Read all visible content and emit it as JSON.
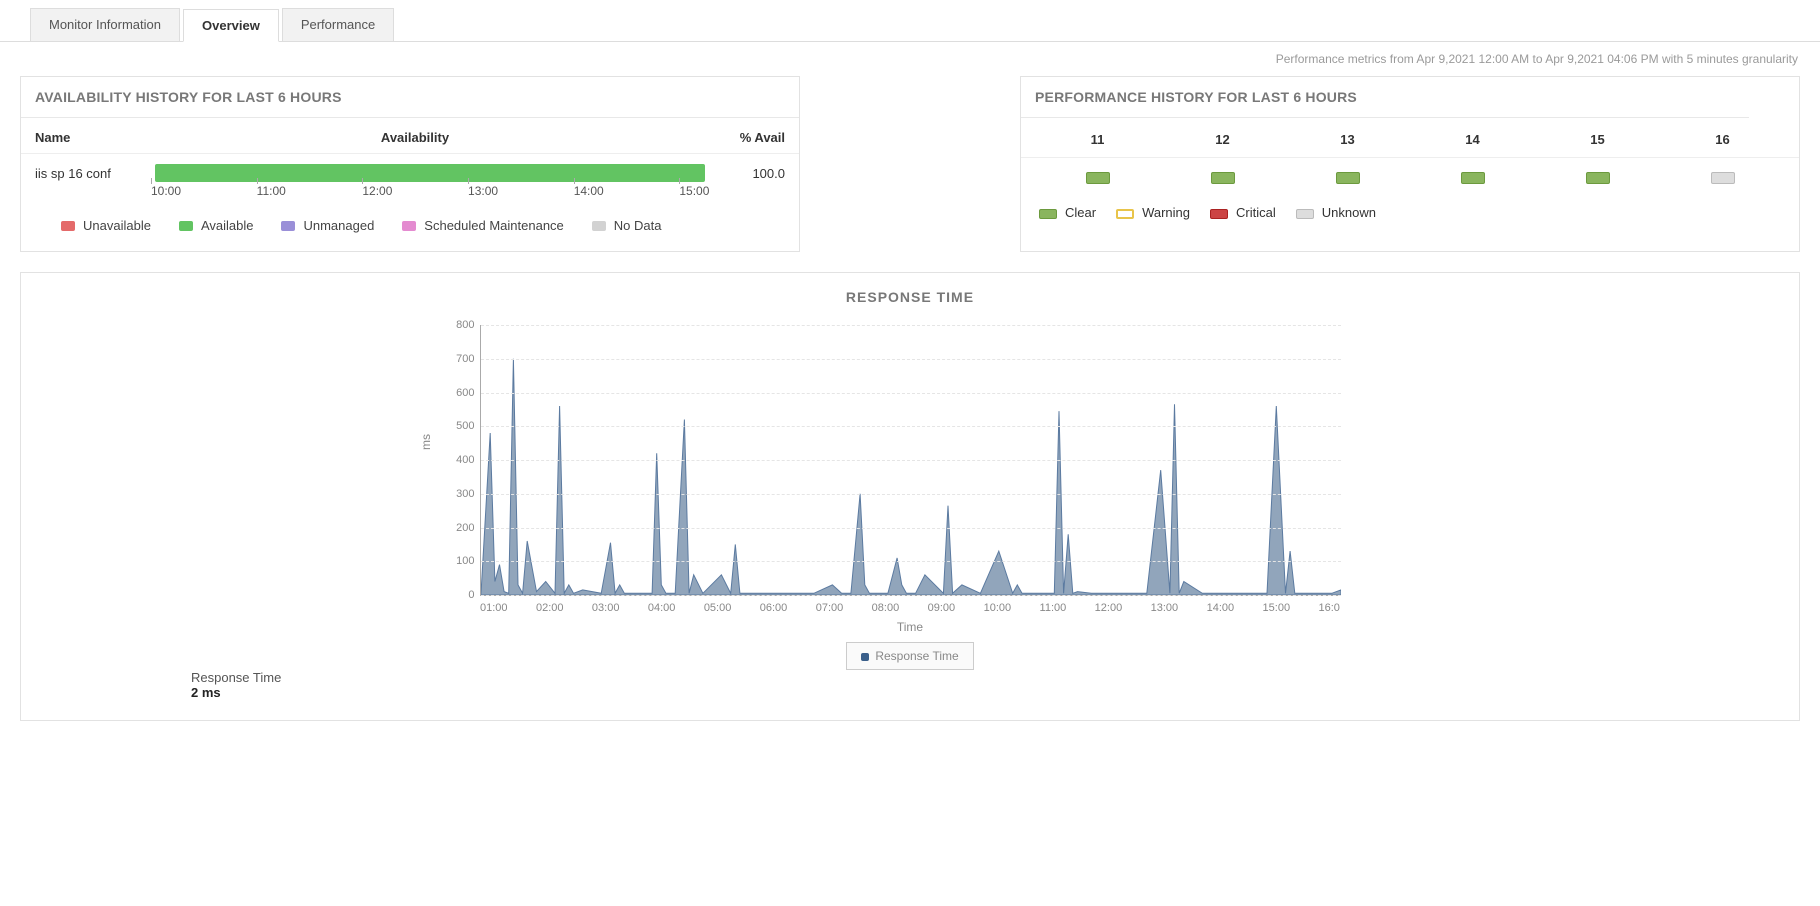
{
  "tabs": {
    "monitor_info": "Monitor Information",
    "overview": "Overview",
    "performance": "Performance"
  },
  "subtitle": "Performance metrics from Apr 9,2021 12:00 AM to Apr 9,2021 04:06 PM with 5 minutes granularity",
  "availability_panel": {
    "title": "AVAILABILITY HISTORY FOR LAST 6 HOURS",
    "head_name": "Name",
    "head_avail": "Availability",
    "head_pct": "% Avail",
    "row_name": "iis sp 16 conf",
    "row_pct": "100.0",
    "axis": [
      "10:00",
      "11:00",
      "12:00",
      "13:00",
      "14:00",
      "15:00"
    ],
    "legend": {
      "unavailable": "Unavailable",
      "available": "Available",
      "unmanaged": "Unmanaged",
      "scheduled": "Scheduled Maintenance",
      "nodata": "No Data"
    }
  },
  "performance_panel": {
    "title": "PERFORMANCE HISTORY FOR LAST 6 HOURS",
    "hours": [
      "11",
      "12",
      "13",
      "14",
      "15",
      "16"
    ],
    "statuses": [
      "clear",
      "clear",
      "clear",
      "clear",
      "clear",
      "unknown"
    ],
    "legend": {
      "clear": "Clear",
      "warning": "Warning",
      "critical": "Critical",
      "unknown": "Unknown"
    }
  },
  "response_panel": {
    "title": "RESPONSE TIME",
    "y_axis_label": "ms",
    "x_axis_label": "Time",
    "legend_label": "Response Time",
    "footer_label": "Response Time",
    "footer_value": "2 ms"
  },
  "chart_data": {
    "type": "area",
    "title": "RESPONSE TIME",
    "ylabel": "ms",
    "xlabel": "Time",
    "ylim": [
      0,
      800
    ],
    "y_ticks": [
      0,
      100,
      200,
      300,
      400,
      500,
      600,
      700,
      800
    ],
    "x_ticks": [
      "01:00",
      "02:00",
      "03:00",
      "04:00",
      "05:00",
      "06:00",
      "07:00",
      "08:00",
      "09:00",
      "10:00",
      "11:00",
      "12:00",
      "13:00",
      "14:00",
      "15:00",
      "16:0"
    ],
    "series": [
      {
        "name": "Response Time",
        "x": [
          "00:30",
          "00:40",
          "00:45",
          "00:50",
          "00:55",
          "01:00",
          "01:05",
          "01:10",
          "01:15",
          "01:20",
          "01:30",
          "01:40",
          "01:50",
          "01:55",
          "02:00",
          "02:05",
          "02:10",
          "02:20",
          "02:40",
          "02:50",
          "02:55",
          "03:00",
          "03:05",
          "03:10",
          "03:20",
          "03:35",
          "03:40",
          "03:45",
          "03:50",
          "04:00",
          "04:10",
          "04:15",
          "04:20",
          "04:30",
          "04:50",
          "05:00",
          "05:05",
          "05:10",
          "05:30",
          "05:50",
          "06:00",
          "06:10",
          "06:30",
          "06:50",
          "07:00",
          "07:10",
          "07:20",
          "07:25",
          "07:30",
          "07:35",
          "07:50",
          "08:00",
          "08:05",
          "08:10",
          "08:20",
          "08:30",
          "08:50",
          "08:55",
          "09:00",
          "09:10",
          "09:30",
          "09:50",
          "10:05",
          "10:10",
          "10:15",
          "10:30",
          "10:50",
          "10:55",
          "11:00",
          "11:05",
          "11:10",
          "11:15",
          "11:30",
          "11:50",
          "12:00",
          "12:10",
          "12:20",
          "12:30",
          "12:45",
          "12:55",
          "13:00",
          "13:05",
          "13:10",
          "13:30",
          "13:50",
          "14:00",
          "14:10",
          "14:20",
          "14:40",
          "14:50",
          "15:00",
          "15:05",
          "15:10",
          "15:30",
          "15:50",
          "16:00"
        ],
        "values": [
          5,
          480,
          40,
          90,
          10,
          5,
          700,
          30,
          5,
          160,
          10,
          40,
          5,
          560,
          5,
          30,
          5,
          15,
          5,
          155,
          5,
          30,
          5,
          5,
          5,
          5,
          420,
          30,
          5,
          5,
          520,
          5,
          60,
          5,
          60,
          5,
          150,
          5,
          5,
          5,
          5,
          5,
          5,
          30,
          5,
          5,
          300,
          30,
          5,
          5,
          5,
          110,
          30,
          5,
          5,
          60,
          5,
          265,
          5,
          30,
          5,
          130,
          5,
          30,
          5,
          5,
          5,
          545,
          5,
          180,
          5,
          10,
          5,
          5,
          5,
          5,
          5,
          5,
          370,
          5,
          565,
          5,
          40,
          5,
          5,
          5,
          5,
          5,
          5,
          560,
          5,
          130,
          5,
          5,
          5,
          15
        ]
      }
    ]
  }
}
